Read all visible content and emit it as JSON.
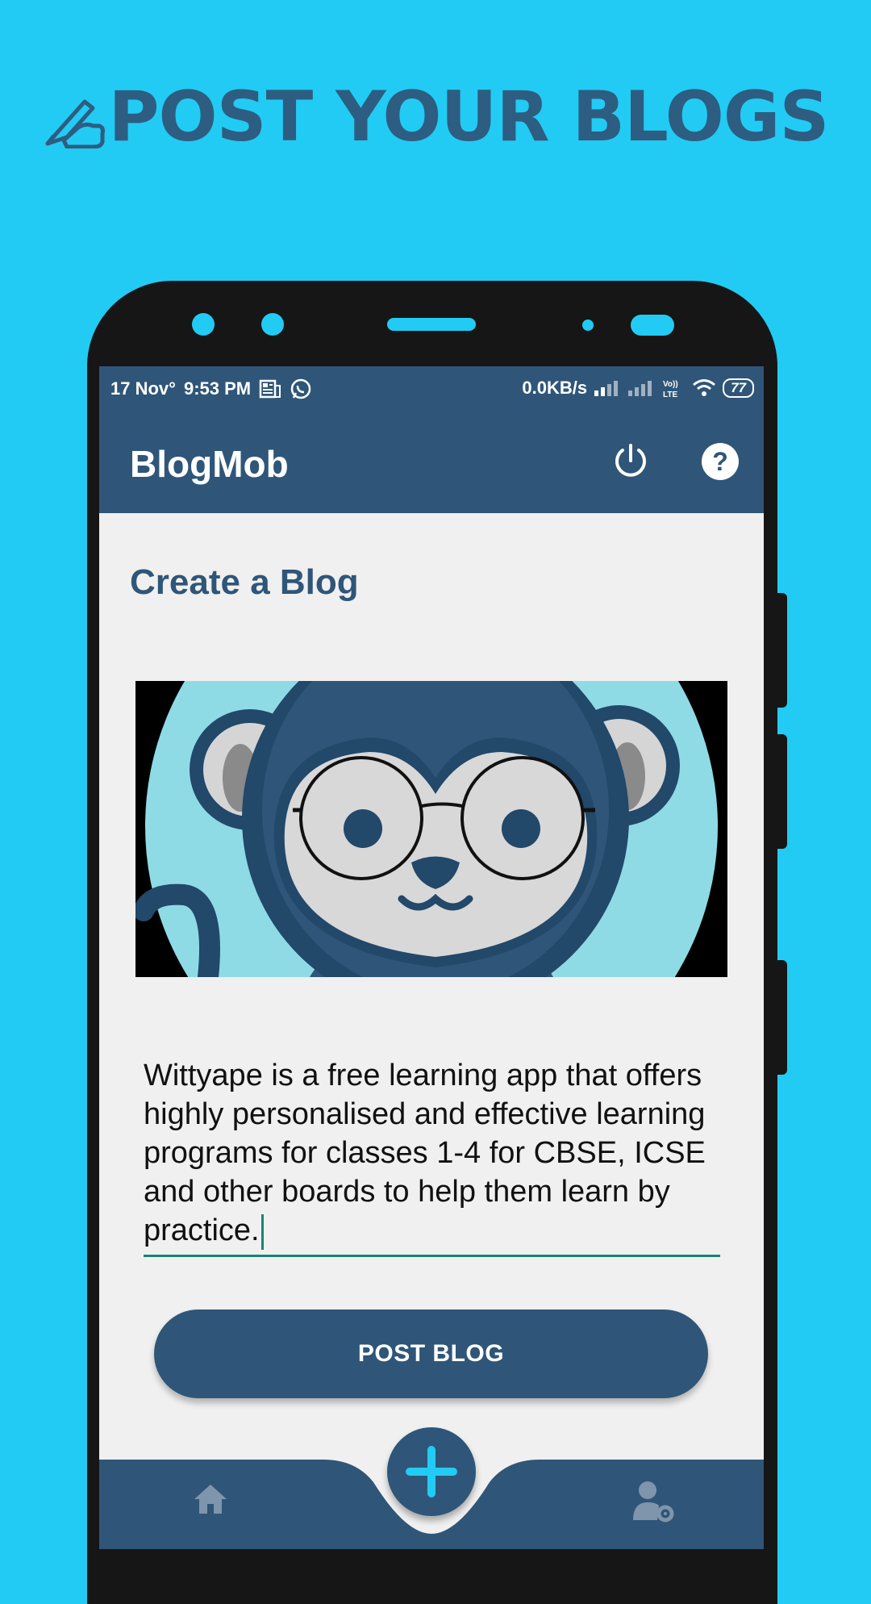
{
  "promo": {
    "title": "POST YOUR BLOGS"
  },
  "status_bar": {
    "date": "17 Nov°",
    "time": "9:53 PM",
    "speed": "0.0KB/s",
    "battery": "77"
  },
  "app_bar": {
    "title": "BlogMob"
  },
  "main": {
    "section_title": "Create a Blog",
    "blog_text": "Wittyape is a free learning app that offers highly personalised and effective learning programs for classes 1-4 for CBSE, ICSE and other boards to help them learn by practice.",
    "post_button": "POST BLOG"
  },
  "bottom_nav": {
    "items": [
      {
        "icon": "home-icon"
      },
      {
        "icon": "add-icon"
      },
      {
        "icon": "user-settings-icon"
      }
    ]
  },
  "colors": {
    "background": "#22cbf3",
    "primary": "#2f5678",
    "accent": "#1a8377",
    "surface": "#f0f0f0"
  }
}
